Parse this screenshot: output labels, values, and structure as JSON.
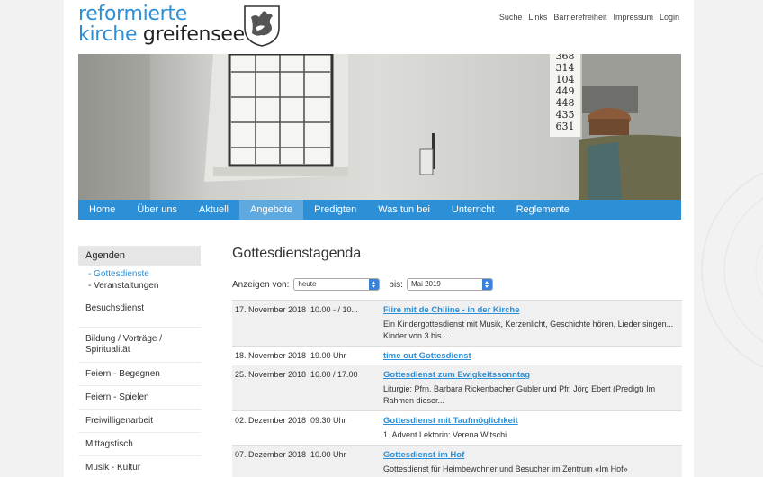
{
  "logo": {
    "line1": "reformierte",
    "line2a": "kirche",
    "line2b": "greifensee"
  },
  "topnav": [
    "Suche",
    "Links",
    "Barrierefreiheit",
    "Impressum",
    "Login"
  ],
  "mainnav": {
    "items": [
      "Home",
      "Über uns",
      "Aktuell",
      "Angebote",
      "Predigten",
      "Was tun bei",
      "Unterricht",
      "Reglemente"
    ],
    "active": "Angebote"
  },
  "hymn_board": [
    "368",
    "314",
    "104",
    "449",
    "448",
    "435",
    "631"
  ],
  "sidebar": {
    "head": "Agenden",
    "subitems": [
      "Gottesdienste",
      "Veranstaltungen"
    ],
    "items": [
      "Besuchsdienst",
      "Bildung / Vorträge / Spiritualität",
      "Feiern - Begegnen",
      "Feiern - Spielen",
      "Freiwilligenarbeit",
      "Mittagstisch",
      "Musik - Kultur"
    ]
  },
  "content": {
    "title": "Gottesdienstagenda",
    "filter_from_label": "Anzeigen von:",
    "filter_from_value": "heute",
    "filter_to_label": "bis:",
    "filter_to_value": "Mai 2019"
  },
  "events": [
    {
      "date": "17. November 2018",
      "time": "10.00 - / 10...",
      "title": "Fiire mit de Chliine - in der Kirche",
      "desc": "Ein Kindergottesdienst mit Musik, Kerzenlicht, Geschichte hören, Lieder singen... Kinder von 3 bis ...",
      "shade": true
    },
    {
      "date": "18. November 2018",
      "time": "19.00 Uhr",
      "title": "time out Gottesdienst",
      "desc": "",
      "shade": false
    },
    {
      "date": "25. November 2018",
      "time": "16.00 / 17.00",
      "title": "Gottesdienst zum Ewigkeitssonntag",
      "desc": "Liturgie: Pfrn. Barbara Rickenbacher Gubler und Pfr. Jörg Ebert (Predigt) Im Rahmen dieser...",
      "shade": true
    },
    {
      "date": "02. Dezember 2018",
      "time": "09.30 Uhr",
      "title": "Gottesdienst mit Taufmöglichkeit",
      "desc": "1. Advent Lektorin: Verena Witschi",
      "shade": false
    },
    {
      "date": "07. Dezember 2018",
      "time": "10.00 Uhr",
      "title": "Gottesdienst im Hof",
      "desc": "Gottesdienst für Heimbewohner und Besucher im Zentrum «Im Hof»",
      "shade": true
    }
  ]
}
